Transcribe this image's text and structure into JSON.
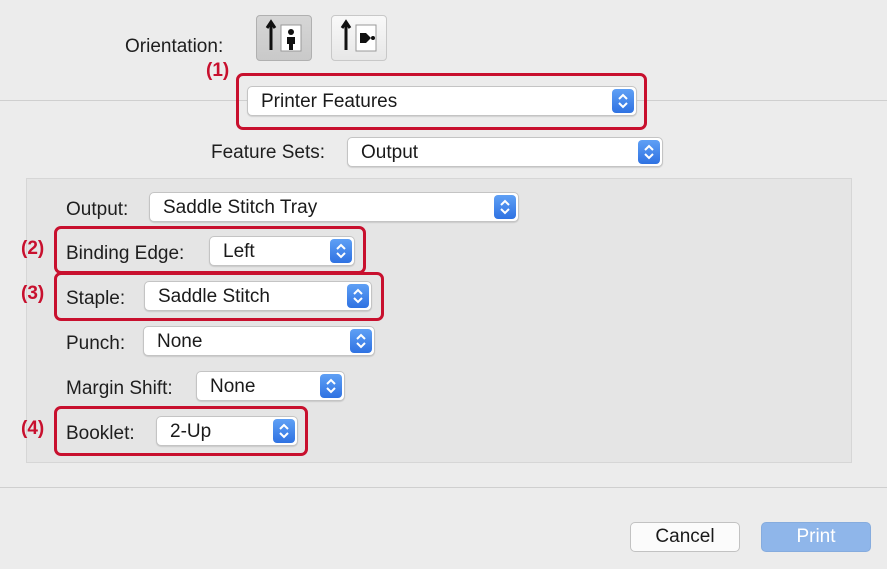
{
  "orientation": {
    "label": "Orientation:",
    "options": [
      "portrait-icon",
      "landscape-icon"
    ],
    "selected": "portrait-icon"
  },
  "panel_select": {
    "value": "Printer Features"
  },
  "feature_sets": {
    "label": "Feature Sets:",
    "value": "Output"
  },
  "fields": {
    "output": {
      "label": "Output:",
      "value": "Saddle Stitch Tray"
    },
    "binding_edge": {
      "label": "Binding Edge:",
      "value": "Left"
    },
    "staple": {
      "label": "Staple:",
      "value": "Saddle Stitch"
    },
    "punch": {
      "label": "Punch:",
      "value": "None"
    },
    "margin_shift": {
      "label": "Margin Shift:",
      "value": "None"
    },
    "booklet": {
      "label": "Booklet:",
      "value": "2-Up"
    }
  },
  "callouts": [
    "(1)",
    "(2)",
    "(3)",
    "(4)"
  ],
  "buttons": {
    "cancel": "Cancel",
    "print": "Print"
  },
  "colors": {
    "callout": "#c8102e",
    "accent": "#2f72e2",
    "print_button": "#8fb6ea"
  }
}
